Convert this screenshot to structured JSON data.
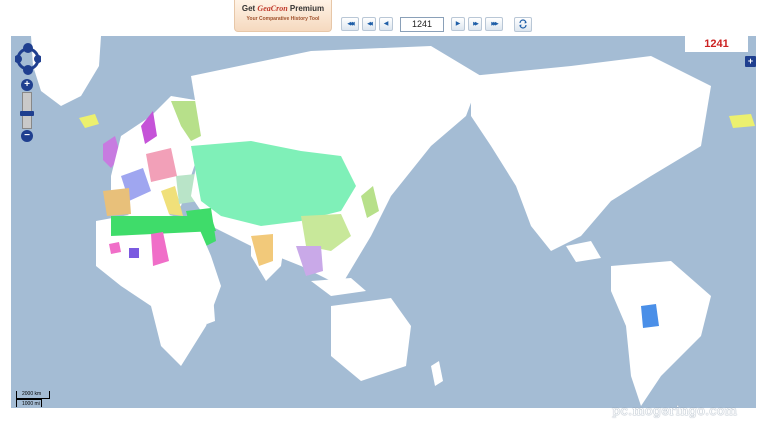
{
  "promo": {
    "title_prefix": "Get ",
    "brand": "GeaCron",
    "title_suffix": " Premium",
    "subtitle": "Your Comparative History Tool"
  },
  "toolbar": {
    "buttons_left": [
      {
        "name": "first-year-button",
        "glyph": "◀◀◀"
      },
      {
        "name": "fast-back-button",
        "glyph": "◀◀"
      },
      {
        "name": "step-back-button",
        "glyph": "◀"
      }
    ],
    "year_value": "1241",
    "buttons_right": [
      {
        "name": "step-forward-button",
        "glyph": "▶"
      },
      {
        "name": "fast-forward-button",
        "glyph": "▶▶"
      },
      {
        "name": "last-year-button",
        "glyph": "▶▶▶"
      }
    ],
    "refresh_icon": "refresh-icon"
  },
  "map": {
    "year_display": "1241",
    "zoom_in": "+",
    "zoom_out": "−",
    "layer_switch": "+",
    "scale_top": "2000 km",
    "scale_bottom": "1000 mi",
    "ocean_color": "#a4bcd4",
    "land_color": "#ffffff"
  },
  "watermark": "pc.mogeringo.com"
}
